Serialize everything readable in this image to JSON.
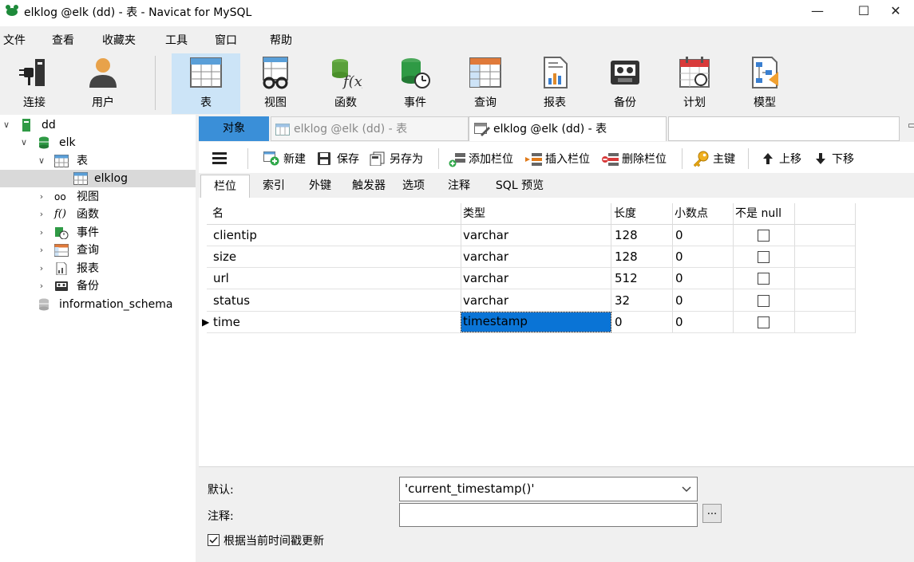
{
  "window": {
    "title": "elklog @elk (dd) - 表 - Navicat for MySQL",
    "minimize": "—",
    "maximize": "☐",
    "close": "✕"
  },
  "menu": [
    "文件",
    "查看",
    "收藏夹",
    "工具",
    "窗口",
    "帮助"
  ],
  "toolbar": {
    "items": [
      {
        "label": "连接",
        "icon": "plug-icon"
      },
      {
        "label": "用户",
        "icon": "user-icon"
      },
      {
        "label": "表",
        "icon": "table-icon"
      },
      {
        "label": "视图",
        "icon": "view-icon"
      },
      {
        "label": "函数",
        "icon": "function-icon"
      },
      {
        "label": "事件",
        "icon": "event-icon"
      },
      {
        "label": "查询",
        "icon": "query-icon"
      },
      {
        "label": "报表",
        "icon": "report-icon"
      },
      {
        "label": "备份",
        "icon": "backup-icon"
      },
      {
        "label": "计划",
        "icon": "schedule-icon"
      },
      {
        "label": "模型",
        "icon": "model-icon"
      }
    ],
    "active": "表"
  },
  "tree": {
    "connection": "dd",
    "database": "elk",
    "tables_group": "表",
    "table": "elklog",
    "groups": [
      "视图",
      "函数",
      "事件",
      "查询",
      "报表",
      "备份"
    ],
    "other_db": "information_schema"
  },
  "tabs": {
    "objects": "对象",
    "doc1": "elklog @elk (dd) - 表",
    "doc2": "elklog @elk (dd) - 表"
  },
  "designer_toolbar": {
    "new": "新建",
    "save": "保存",
    "save_as": "另存为",
    "add_field": "添加栏位",
    "insert_field": "插入栏位",
    "delete_field": "删除栏位",
    "primary_key": "主键",
    "move_up": "上移",
    "move_down": "下移"
  },
  "subtabs": [
    "栏位",
    "索引",
    "外键",
    "触发器",
    "选项",
    "注释",
    "SQL 预览"
  ],
  "grid": {
    "columns": [
      "名",
      "类型",
      "长度",
      "小数点",
      "不是 null"
    ],
    "rows": [
      {
        "name": "clientip",
        "type": "varchar",
        "length": "128",
        "decimals": "0"
      },
      {
        "name": "size",
        "type": "varchar",
        "length": "128",
        "decimals": "0"
      },
      {
        "name": "url",
        "type": "varchar",
        "length": "512",
        "decimals": "0"
      },
      {
        "name": "status",
        "type": "varchar",
        "length": "32",
        "decimals": "0"
      },
      {
        "name": "time",
        "type": "timestamp",
        "length": "0",
        "decimals": "0"
      }
    ]
  },
  "properties": {
    "default_label": "默认:",
    "default_value": "'current_timestamp()'",
    "comment_label": "注释:",
    "comment_value": "",
    "ellipsis": "...",
    "update_label": "根据当前时间戳更新",
    "update_checked": true
  },
  "colors": {
    "accent": "#3a8fd8",
    "selection": "#0a74d6",
    "toolbar_active": "#cce4f7",
    "tree_selected": "#d9d9d9"
  }
}
